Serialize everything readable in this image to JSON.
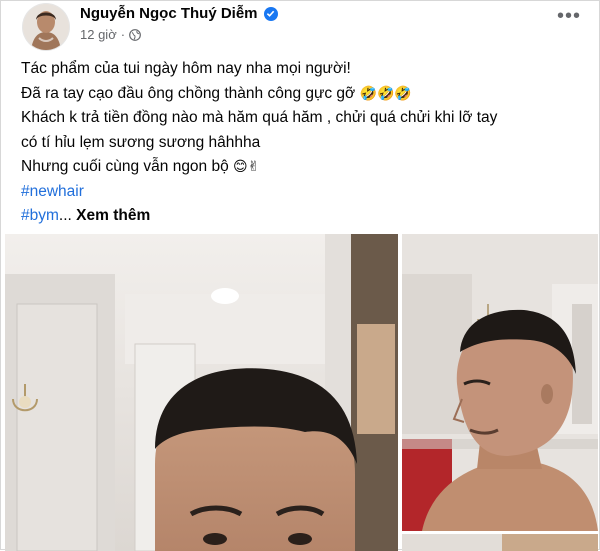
{
  "post": {
    "author": "Nguyễn Ngọc Thuý Diễm",
    "verified": true,
    "time": "12 giờ",
    "separator": "·",
    "audience_icon": "globe-icon",
    "more_icon": "more-options-icon",
    "more_label": "•••",
    "lines": [
      "Tác phẩm của tui ngày hôm nay nha mọi người!",
      "Đã ra tay cạo đầu ông chồng thành công gực gỡ",
      "Khách k trả tiền đồng nào mà hăm quá hăm , chửi quá chửi khi lỡ tay",
      "có tí hỉu lẹm sương sương hâhhha",
      "Nhưng cuối cùng vẫn ngon bộ"
    ],
    "line2_emoji": "🤣🤣🤣",
    "line5_emoji": "😊✌",
    "hashtag1": "#newhair",
    "hashtag2": "#bym",
    "ellipsis": "...",
    "see_more": "Xem thêm"
  },
  "colors": {
    "link": "#216fdb",
    "verified": "#1877f2",
    "secondary_text": "#65676b"
  }
}
